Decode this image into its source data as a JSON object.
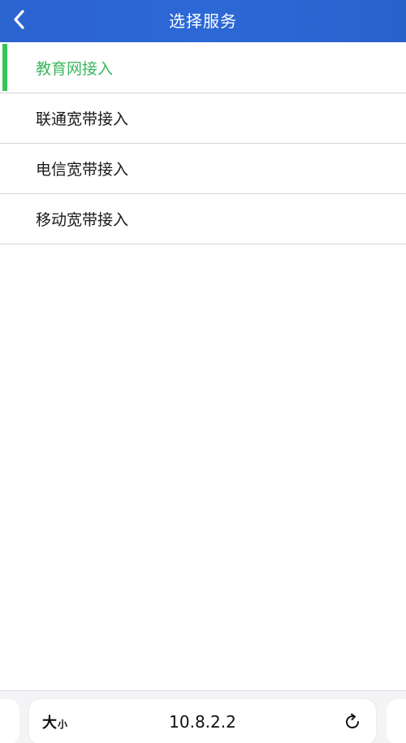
{
  "header": {
    "title": "选择服务",
    "back_icon": "chevron-left-icon"
  },
  "services": [
    {
      "label": "教育网接入",
      "selected": true
    },
    {
      "label": "联通宽带接入",
      "selected": false
    },
    {
      "label": "电信宽带接入",
      "selected": false
    },
    {
      "label": "移动宽带接入",
      "selected": false
    }
  ],
  "browser_bar": {
    "text_size_big": "大",
    "text_size_small": "小",
    "url": "10.8.2.2",
    "reload_icon": "reload-icon"
  },
  "colors": {
    "header_bg": "#2b63cf",
    "selected_text": "#3bb85d",
    "selected_bar": "#36c45a",
    "divider": "#d6d6d6"
  }
}
